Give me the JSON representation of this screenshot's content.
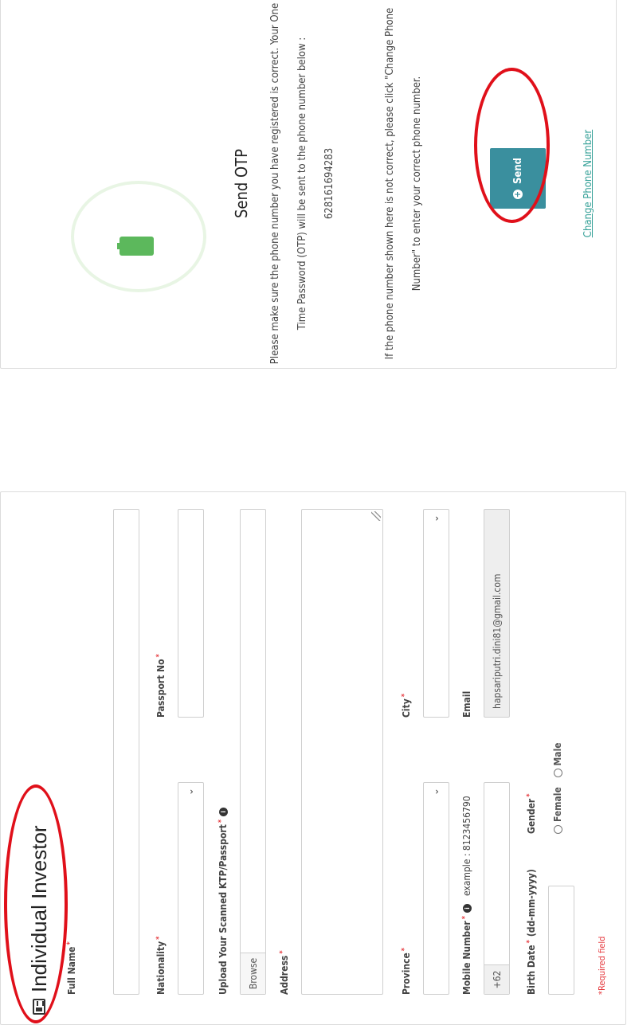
{
  "form": {
    "title": "Individual Investor",
    "full_name_label": "Full Name",
    "nationality_label": "Nationality",
    "passport_label": "Passport No",
    "upload_label": "Upload Your Scanned KTP/Passport",
    "browse_label": "Browse",
    "address_label": "Address",
    "province_label": "Province",
    "city_label": "City",
    "mobile_label": "Mobile Number",
    "mobile_example": "example : 8123456790",
    "mobile_prefix": "+62",
    "email_label": "Email",
    "email_value": "hapsariputri.dini81@gmail.com",
    "birth_label": "Birth Date",
    "birth_format": "(dd-mm-yyyy)",
    "gender_label": "Gender",
    "gender_female": "Female",
    "gender_male": "Male",
    "required_note": "Required field",
    "required_mark": "*"
  },
  "otp": {
    "title": "Send OTP",
    "line1": "Please make sure the phone number you have registered is correct. Your One",
    "line2": "Time Password (OTP) will be sent to the phone number below :",
    "phone": "628161694283",
    "line3": "If the phone number shown here is not correct, please click \"Change Phone",
    "line4": "Number\" to enter your correct phone number.",
    "send_label": "Send",
    "change_link": "Change Phone Number"
  },
  "icons": {
    "title_icon": "id-card-icon",
    "info_icon": "info-icon",
    "phone_icon": "mobile-phone-icon",
    "send_icon": "plus-circle-icon",
    "select_icon": "chevron-down-icon"
  },
  "colors": {
    "send_button": "#3a8f9e",
    "link": "#3aa39a",
    "required": "#e5373c",
    "phone_icon": "#5cb85c",
    "annotation": "#e0101a"
  }
}
